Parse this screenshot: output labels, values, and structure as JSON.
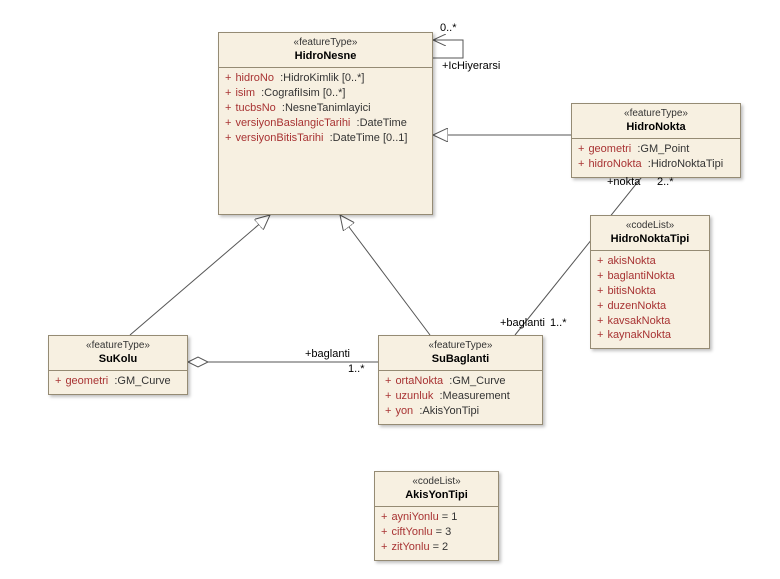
{
  "classes": {
    "hidroNesne": {
      "stereotype": "«featureType»",
      "name": "HidroNesne",
      "attrs": [
        {
          "name": "hidroNo",
          "type": ":HidroKimlik [0..*]"
        },
        {
          "name": "isim",
          "type": ":CografiIsim [0..*]"
        },
        {
          "name": "tucbsNo",
          "type": ":NesneTanimlayici"
        },
        {
          "name": "versiyonBaslangicTarihi",
          "type": ":DateTime"
        },
        {
          "name": "versiyonBitisTarihi",
          "type": ":DateTime [0..1]"
        }
      ]
    },
    "hidroNokta": {
      "stereotype": "«featureType»",
      "name": "HidroNokta",
      "attrs": [
        {
          "name": "geometri",
          "type": ":GM_Point"
        },
        {
          "name": "hidroNokta",
          "type": ":HidroNoktaTipi"
        }
      ]
    },
    "hidroNoktaTipi": {
      "stereotype": "«codeList»",
      "name": "HidroNoktaTipi",
      "enums": [
        {
          "name": "akisNokta"
        },
        {
          "name": "baglantiNokta"
        },
        {
          "name": "bitisNokta"
        },
        {
          "name": "duzenNokta"
        },
        {
          "name": "kavsakNokta"
        },
        {
          "name": "kaynakNokta"
        }
      ]
    },
    "suKolu": {
      "stereotype": "«featureType»",
      "name": "SuKolu",
      "attrs": [
        {
          "name": "geometri",
          "type": ":GM_Curve"
        }
      ]
    },
    "suBaglanti": {
      "stereotype": "«featureType»",
      "name": "SuBaglanti",
      "attrs": [
        {
          "name": "ortaNokta",
          "type": ":GM_Curve"
        },
        {
          "name": "uzunluk",
          "type": ":Measurement"
        },
        {
          "name": "yon",
          "type": ":AkisYonTipi"
        }
      ]
    },
    "akisYonTipi": {
      "stereotype": "«codeList»",
      "name": "AkisYonTipi",
      "enums": [
        {
          "name": "ayniYonlu",
          "value": "1"
        },
        {
          "name": "ciftYonlu",
          "value": "3"
        },
        {
          "name": "zitYonlu",
          "value": "2"
        }
      ]
    }
  },
  "labels": {
    "selfRole": "+IcHiyerarsi",
    "selfMult": "0..*",
    "baglantiRole": "+baglanti",
    "baglantiMult": "1..*",
    "baglantiRole2": "+baglanti",
    "baglantiMult2": "1..*",
    "noktaRole": "+nokta",
    "noktaMult": "2..*"
  },
  "chart_data": {
    "type": "table",
    "description": "UML class diagram",
    "classes": [
      {
        "name": "HidroNesne",
        "stereotype": "featureType",
        "attributes": [
          "hidroNo:HidroKimlik[0..*]",
          "isim:CografiIsim[0..*]",
          "tucbsNo:NesneTanimlayici",
          "versiyonBaslangicTarihi:DateTime",
          "versiyonBitisTarihi:DateTime[0..1]"
        ]
      },
      {
        "name": "HidroNokta",
        "stereotype": "featureType",
        "attributes": [
          "geometri:GM_Point",
          "hidroNokta:HidroNoktaTipi"
        ]
      },
      {
        "name": "HidroNoktaTipi",
        "stereotype": "codeList",
        "literals": [
          "akisNokta",
          "baglantiNokta",
          "bitisNokta",
          "duzenNokta",
          "kavsakNokta",
          "kaynakNokta"
        ]
      },
      {
        "name": "SuKolu",
        "stereotype": "featureType",
        "attributes": [
          "geometri:GM_Curve"
        ]
      },
      {
        "name": "SuBaglanti",
        "stereotype": "featureType",
        "attributes": [
          "ortaNokta:GM_Curve",
          "uzunluk:Measurement",
          "yon:AkisYonTipi"
        ]
      },
      {
        "name": "AkisYonTipi",
        "stereotype": "codeList",
        "literals": [
          "ayniYonlu=1",
          "ciftYonlu=3",
          "zitYonlu=2"
        ]
      }
    ],
    "relationships": [
      {
        "from": "HidroNokta",
        "to": "HidroNesne",
        "type": "generalization"
      },
      {
        "from": "SuKolu",
        "to": "HidroNesne",
        "type": "generalization"
      },
      {
        "from": "SuBaglanti",
        "to": "HidroNesne",
        "type": "generalization"
      },
      {
        "from": "HidroNesne",
        "to": "HidroNesne",
        "type": "association",
        "role": "+IcHiyerarsi",
        "mult": "0..*"
      },
      {
        "from": "SuKolu",
        "to": "SuBaglanti",
        "type": "aggregation",
        "role": "+baglanti",
        "mult": "1..*"
      },
      {
        "from": "SuBaglanti",
        "to": "HidroNokta",
        "type": "association",
        "role_a": "+baglanti 1..*",
        "role_b": "+nokta 2..*"
      }
    ]
  }
}
